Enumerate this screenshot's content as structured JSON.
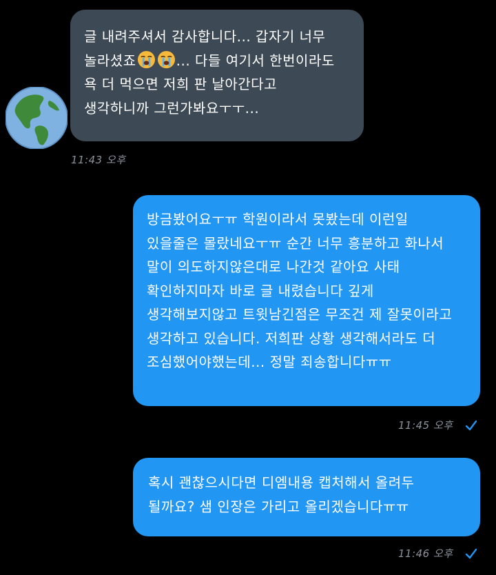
{
  "messages": [
    {
      "direction": "incoming",
      "lines": [
        "글 내려주셔서 감사합니다... 갑자기 너무",
        [
          "놀라셨죠",
          "loudly-crying-face-icon",
          "loudly-crying-face-icon",
          "... 다들 여기서 한번이라도"
        ],
        "욕 더 먹으면 저희 판 날아간다고",
        "생각하니까 그런가봐요ㅜㅜ..."
      ],
      "time": "11:43 오후"
    },
    {
      "direction": "outgoing",
      "lines": [
        "방금봤어요ㅜㅠ 학원이라서 못봤는데 이런일",
        "있을줄은 몰랐네요ㅜㅠ 순간 너무 흥분하고 화나서",
        "말이 의도하지않은대로 나간것 같아요 사태",
        "확인하지마자 바로 글 내렸습니다 깊게",
        "생각해보지않고 트윗남긴점은 무조건 제 잘못이라고",
        "생각하고 있습니다. 저희판 상황 생각해서라도 더",
        "조심했어야했는데... 정말 죄송합니다ㅠㅠ"
      ],
      "time": "11:45 오후",
      "status_icon": "read-check-icon"
    },
    {
      "direction": "outgoing",
      "lines": [
        "혹시 괜찮으시다면 디엠내용 캡처해서 올려두",
        "될까요? 샘 인장은 가리고 올리겠습니다ㅠㅠ"
      ],
      "time": "11:46 오후",
      "status_icon": "read-check-icon"
    }
  ],
  "avatar": {
    "icon": "globe-americas-icon"
  },
  "colors": {
    "background": "#000000",
    "incoming_bubble": "#3d4a56",
    "outgoing_bubble": "#2196f3",
    "timestamp": "#8a939c",
    "check": "#2196f3"
  }
}
